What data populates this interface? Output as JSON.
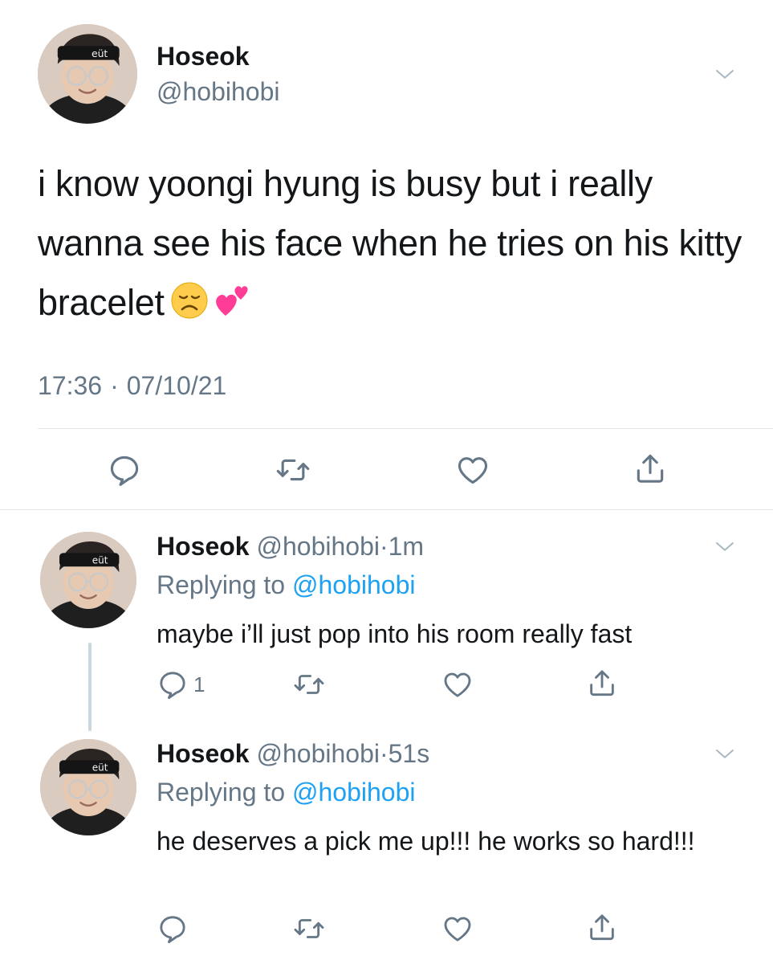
{
  "main_tweet": {
    "name": "Hoseok",
    "handle": "@hobihobi",
    "text": "i know yoongi hyung is busy but i really wanna see his face when he tries on his kitty bracelet",
    "emojis": [
      "disappointed-face-icon",
      "two-hearts-icon"
    ],
    "time": "17:36",
    "separator": "·",
    "date": "07/10/21"
  },
  "replies": [
    {
      "name": "Hoseok",
      "handle": "@hobihobi",
      "dot": "·",
      "time": "1m",
      "replying_prefix": "Replying to",
      "replying_to": "@hobihobi",
      "text": "maybe i’ll just pop into his room really fast",
      "reply_count": "1"
    },
    {
      "name": "Hoseok",
      "handle": "@hobihobi",
      "dot": "·",
      "time": "51s",
      "replying_prefix": "Replying to",
      "replying_to": "@hobihobi",
      "text": "he deserves a pick me up!!! he works so hard!!!",
      "reply_count": ""
    }
  ],
  "colors": {
    "text": "#14171a",
    "secondary": "#657786",
    "link": "#1da1f2",
    "divider": "#e1e8ed"
  }
}
